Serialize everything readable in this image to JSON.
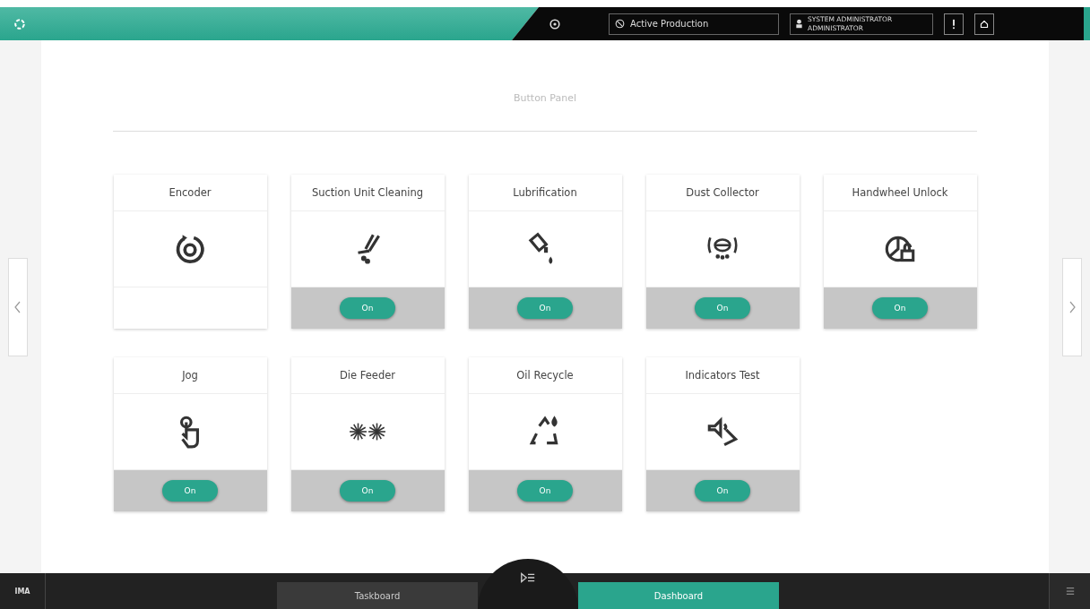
{
  "header": {
    "status": "Active Production",
    "user": {
      "name": "SYSTEM ADMINISTRATOR",
      "role": "ADMINISTRATOR"
    }
  },
  "panel": {
    "title": "Button Panel",
    "cards": [
      {
        "title": "Encoder"
      },
      {
        "title": "Suction Unit Cleaning",
        "button": "On"
      },
      {
        "title": "Lubrification",
        "button": "On"
      },
      {
        "title": "Dust Collector",
        "button": "On"
      },
      {
        "title": "Handwheel Unlock",
        "button": "On"
      },
      {
        "title": "Jog",
        "button": "On"
      },
      {
        "title": "Die Feeder",
        "button": "On"
      },
      {
        "title": "Oil Recycle",
        "button": "On"
      },
      {
        "title": "Indicators Test",
        "button": "On"
      }
    ]
  },
  "footer": {
    "logo": "IMA",
    "tabs": [
      {
        "label": "Taskboard",
        "selected": false
      },
      {
        "label": "Dashboard",
        "selected": true
      }
    ]
  }
}
